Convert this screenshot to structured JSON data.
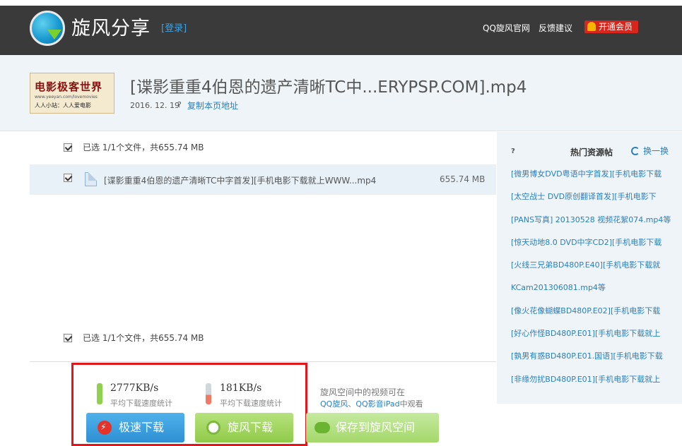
{
  "header": {
    "brand": "旋风分享",
    "login": "[登录]",
    "nav": [
      "QQ旋风官网",
      "反馈建议"
    ],
    "vip_label": "开通会员"
  },
  "file": {
    "thumbnail_title": "电影极客世界",
    "thumbnail_url": "www.yeeyan.com/lovemovies",
    "thumbnail_sub": "人人小站：人人爱电影",
    "title": "[谍影重重4伯恩的遗产清晰TC中...ERYPSP.COM].mp4",
    "date": "2016. 12. 19",
    "separator": "?",
    "copy_link": "复制本页地址"
  },
  "list": {
    "selected_summary": "已选 1/1个文件，共655.74 MB",
    "rows": [
      {
        "name": "[谍影重重4伯恩的遗产清晰TC中字首发][手机电影下载就上WWW...mp4",
        "size": "655.74 MB"
      }
    ]
  },
  "download": {
    "speed_fast": "2777KB/s",
    "speed_fast_label": "平均下载速度统计",
    "speed_normal": "181KB/s",
    "speed_normal_label": "平均下载速度统计",
    "btn_fast": "极速下载",
    "btn_xuanfeng": "旋风下载",
    "btn_save": "保存到旋风空间",
    "note_line1": "旋风空间中的视频可在",
    "note_link1": "QQ旋风",
    "note_sep": "、",
    "note_link2": "QQ影音iPad",
    "note_tail": "中观看"
  },
  "sidebar": {
    "q": "?",
    "title": "热门资源帖",
    "refresh": "换一换",
    "items": [
      "[微男博女DVD粤语中字首发][手机电影下载",
      "[太空战士 DVD原创翻译首发][手机电影下",
      "[PANS写真] 20130528 视频花絮074.mp4等",
      "[惊天动地8.0 DVD中字CD2][手机电影下载",
      "[火线三兄弟BD480P.E40][手机电影下载就",
      "KCam201306081.mp4等",
      "[像火花像蝴蝶BD480P.E02][手机电影下载",
      "[好心作怪BD480P.E01][手机电影下载就上",
      "[孰男有惑BD480P.E01.国语][手机电影下载",
      "[非缘勿扰BD480P.E01][手机电影下载就上"
    ]
  },
  "colors": {
    "header_bg": "#3a3a3a",
    "band_bg": "#eef4f8",
    "link": "#2a7fc0",
    "highlight_box": "#e3161b",
    "vip": "#d9261c"
  }
}
